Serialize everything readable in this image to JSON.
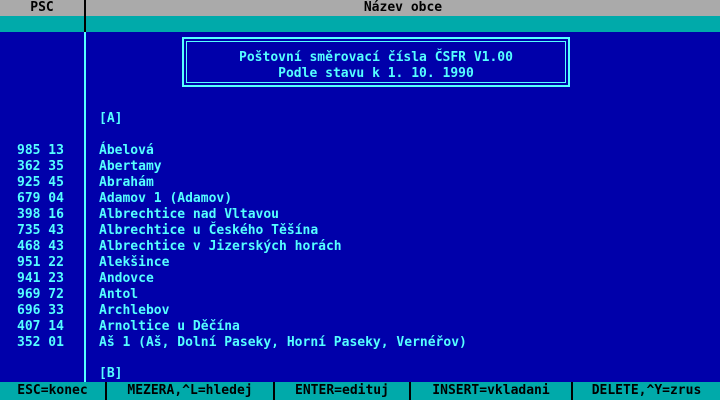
{
  "header": {
    "col_psc": "PSČ",
    "col_name": "Název obce"
  },
  "info": {
    "line1": "Poštovní směrovací čísla ČSFR  V1.00",
    "line2": "Podle stavu k  1. 10. 1990"
  },
  "letters": {
    "a": "[A]",
    "b": "[B]"
  },
  "rows": [
    {
      "psc": "985 13",
      "name": "Ábelová"
    },
    {
      "psc": "362 35",
      "name": "Abertamy"
    },
    {
      "psc": "925 45",
      "name": "Abrahám"
    },
    {
      "psc": "679 04",
      "name": "Adamov 1 (Adamov)"
    },
    {
      "psc": "398 16",
      "name": "Albrechtice nad Vltavou"
    },
    {
      "psc": "735 43",
      "name": "Albrechtice u Českého Těšína"
    },
    {
      "psc": "468 43",
      "name": "Albrechtice v Jizerských horách"
    },
    {
      "psc": "951 22",
      "name": "Alekšince"
    },
    {
      "psc": "941 23",
      "name": "Andovce"
    },
    {
      "psc": "969 72",
      "name": "Antol"
    },
    {
      "psc": "696 33",
      "name": "Archlebov"
    },
    {
      "psc": "407 14",
      "name": "Arnoltice u Děčína"
    },
    {
      "psc": "352 01",
      "name": "Aš 1 (Aš, Dolní Paseky, Horní Paseky, Vernéřov)"
    }
  ],
  "footer": {
    "esc": "ESC=konec",
    "mezera": "MEZERA,^L=hledej",
    "enter": "ENTER=edituj",
    "insert": "INSERT=vkladani",
    "delete": "DELETE,^Y=zrus"
  },
  "colors": {
    "background": "#0000aa",
    "text": "#55ffff",
    "header_bg": "#aaaaaa",
    "band_bg": "#00aaaa"
  }
}
